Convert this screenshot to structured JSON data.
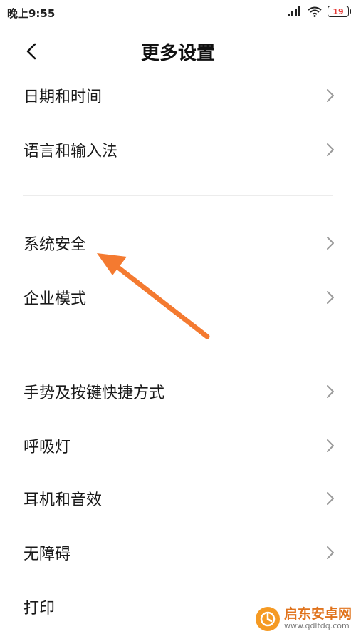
{
  "status_bar": {
    "time": "晚上9:55",
    "battery": "19",
    "battery_color": "#e53935",
    "icons": [
      "signal-icon",
      "wifi-icon",
      "battery-icon"
    ]
  },
  "header": {
    "back_icon": "chevron-left-icon",
    "title": "更多设置"
  },
  "groups": [
    {
      "items": [
        "日期和时间",
        "语言和输入法"
      ]
    },
    {
      "items": [
        "系统安全",
        "企业模式"
      ]
    },
    {
      "items": [
        "手势及按键快捷方式",
        "呼吸灯",
        "耳机和音效",
        "无障碍",
        "打印"
      ]
    }
  ],
  "item_chevron_icon": "chevron-right-icon",
  "annotation": {
    "type": "arrow",
    "color": "#f47a30",
    "points_to": "系统安全"
  },
  "watermark": {
    "title": "启东安卓网",
    "url": "www.qdltdq.com",
    "logo_color": "#f59a23"
  }
}
